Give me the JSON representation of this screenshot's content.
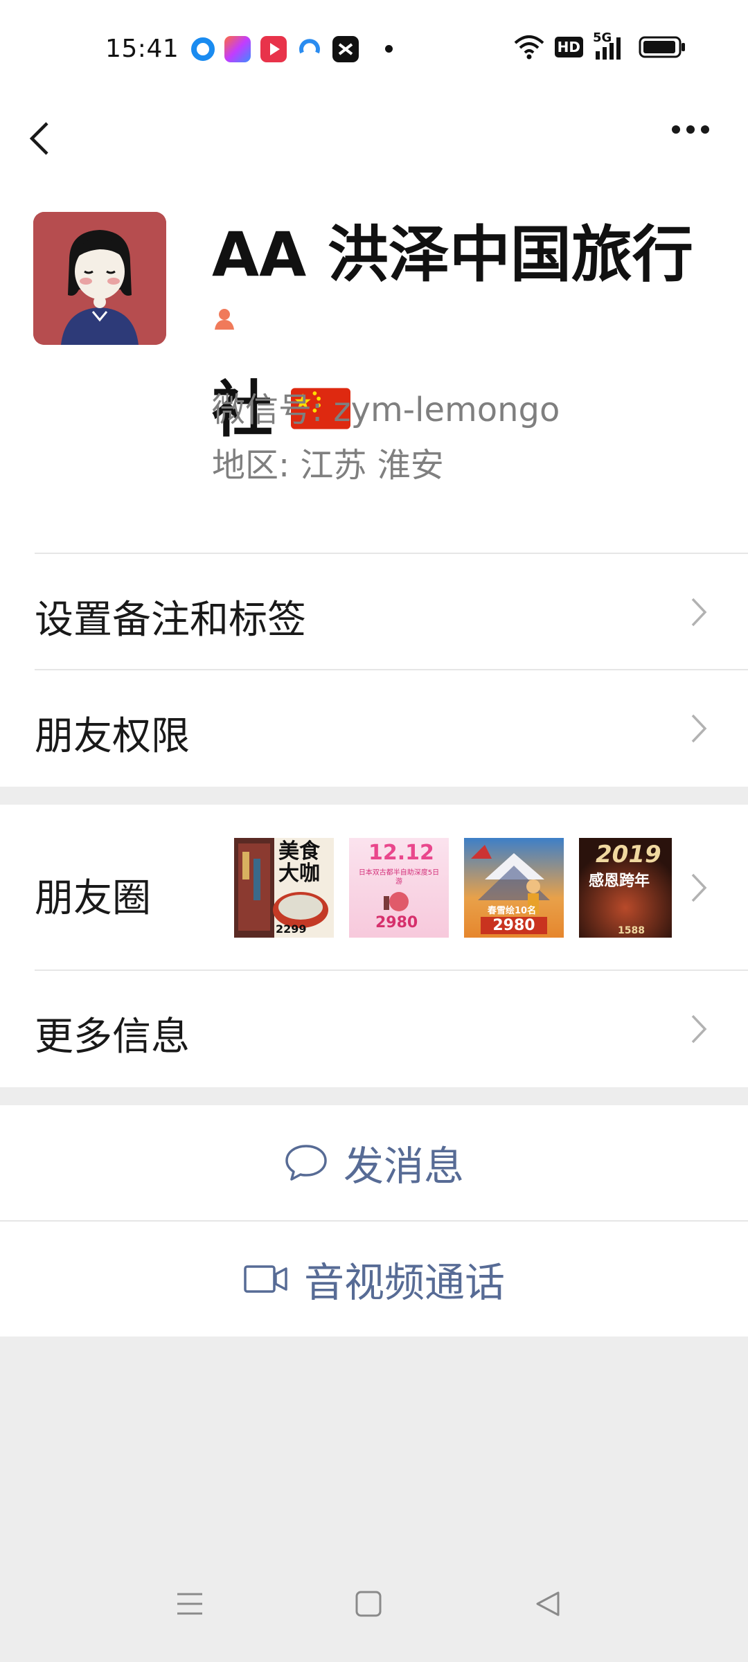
{
  "status_bar": {
    "time": "15:41",
    "hd_label": "HD",
    "network_label": "5G"
  },
  "profile": {
    "name_line1": "AA 洪泽中国旅行",
    "name_line2": "社",
    "wechat_id": "微信号:  zym-lemongo",
    "region": "地区:  江苏  淮安"
  },
  "menu": {
    "remarks_tags": "设置备注和标签",
    "friend_permissions": "朋友权限",
    "moments": "朋友圈",
    "more_info": "更多信息"
  },
  "moments_thumbs": [
    {
      "text_top": "美食大咖",
      "price": "2299"
    },
    {
      "text_top": "12.12",
      "text_mid": "日本双古都半自助深度5日游",
      "price": "2980"
    },
    {
      "text_mid": "春雪绘10名",
      "price": "2980"
    },
    {
      "text_top": "2019",
      "text_mid": "感恩跨年",
      "price": "1588"
    }
  ],
  "actions": {
    "send_message": "发消息",
    "av_call": "音视频通话"
  },
  "colors": {
    "link_blue": "#576b95",
    "background": "#ededed",
    "avatar_red": "#b64d4f"
  }
}
